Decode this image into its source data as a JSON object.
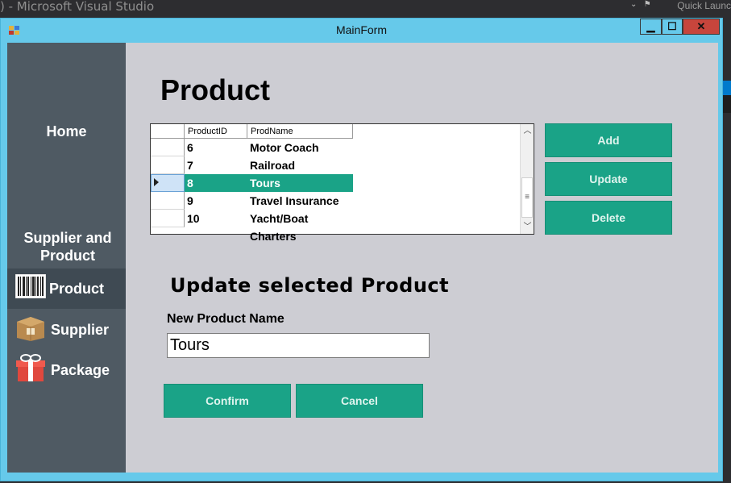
{
  "vs": {
    "title": ") - Microsoft Visual Studio",
    "quick_launch": "Quick Launc"
  },
  "window": {
    "title": "MainForm",
    "controls": {
      "minimize": "▁",
      "maximize": "☐",
      "close": "✕"
    }
  },
  "sidebar": {
    "home": "Home",
    "section": "Supplier and Product",
    "items": [
      {
        "label": "Product",
        "icon": "barcode-icon",
        "active": true
      },
      {
        "label": "Supplier",
        "icon": "box-icon",
        "active": false
      },
      {
        "label": "Package",
        "icon": "gift-icon",
        "active": false
      }
    ]
  },
  "main": {
    "title": "Product",
    "grid": {
      "columns": [
        "ProductID",
        "ProdName"
      ],
      "rows": [
        {
          "id": "6",
          "name": "Motor Coach",
          "selected": false
        },
        {
          "id": "7",
          "name": "Railroad",
          "selected": false
        },
        {
          "id": "8",
          "name": "Tours",
          "selected": true
        },
        {
          "id": "9",
          "name": "Travel Insurance",
          "selected": false
        },
        {
          "id": "10",
          "name": "Yacht/Boat Charters",
          "selected": false
        }
      ]
    },
    "buttons": {
      "add": "Add",
      "update": "Update",
      "delete": "Delete"
    },
    "update_section": {
      "title": "Update selected Product",
      "field_label": "New Product Name",
      "field_value": "Tours",
      "confirm": "Confirm",
      "cancel": "Cancel"
    }
  },
  "colors": {
    "accent": "#1aa387",
    "sidebar": "#4f5a63",
    "titlebar": "#66c9ea",
    "content": "#cdcdd3"
  }
}
